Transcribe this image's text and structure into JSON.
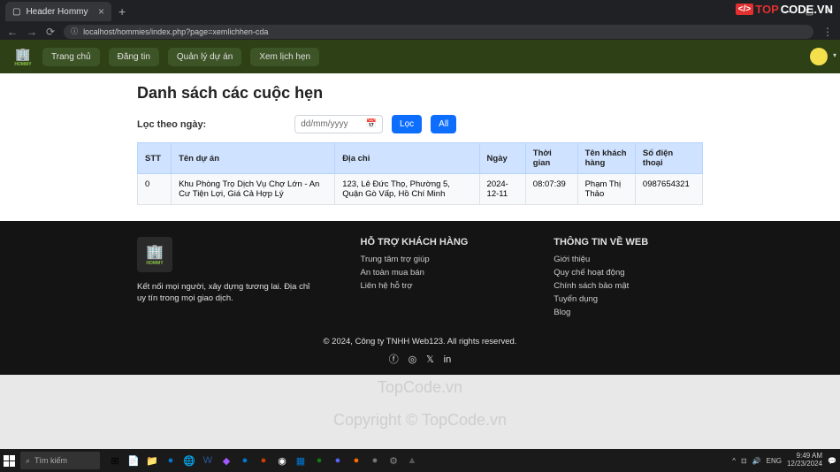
{
  "browser": {
    "tab_title": "Header Hommy",
    "url": "localhost/hommies/index.php?page=xemlichhen-cda"
  },
  "overlay": {
    "prefix": "TOP",
    "suffix": "CODE.VN"
  },
  "nav": {
    "brand": "HOMMY",
    "items": [
      "Trang chủ",
      "Đăng tin",
      "Quản lý dự án",
      "Xem lịch hẹn"
    ]
  },
  "page": {
    "title": "Danh sách các cuộc hẹn",
    "filter_label": "Lọc theo ngày:",
    "date_placeholder": "dd/mm/yyyy",
    "btn_filter": "Lọc",
    "btn_all": "All"
  },
  "table": {
    "headers": [
      "STT",
      "Tên dự án",
      "Địa chỉ",
      "Ngày",
      "Thời gian",
      "Tên khách hàng",
      "Số điện thoại"
    ],
    "rows": [
      {
        "stt": "0",
        "project": "Khu Phòng Trọ Dịch Vụ Chợ Lớn - An Cư Tiện Lợi, Giá Cả Hợp Lý",
        "address": "123, Lê Đức Thọ, Phường 5, Quận Gò Vấp, Hồ Chí Minh",
        "date": "2024-12-11",
        "time": "08:07:39",
        "customer": "Phạm Thị Thảo",
        "phone": "0987654321"
      }
    ]
  },
  "footer": {
    "brand": "HOMMY",
    "tagline": "Kết nối mọi người, xây dựng tương lai. Địa chỉ uy tín trong mọi giao dịch.",
    "col2_title": "HỖ TRỢ KHÁCH HÀNG",
    "col2_links": [
      "Trung tâm trợ giúp",
      "An toàn mua bán",
      "Liên hệ hỗ trợ"
    ],
    "col3_title": "THÔNG TIN VỀ WEB",
    "col3_links": [
      "Giới thiệu",
      "Quy chế hoạt động",
      "Chính sách bảo mật",
      "Tuyển dụng",
      "Blog"
    ],
    "copyright": "© 2024, Công ty TNHH Web123. All rights reserved."
  },
  "watermark": {
    "text1": "TopCode.vn",
    "text2": "Copyright © TopCode.vn"
  },
  "taskbar": {
    "search": "Tìm kiếm",
    "time": "9:49 AM",
    "date": "12/23/2024",
    "lang": "ENG",
    "sound": "🔊"
  }
}
